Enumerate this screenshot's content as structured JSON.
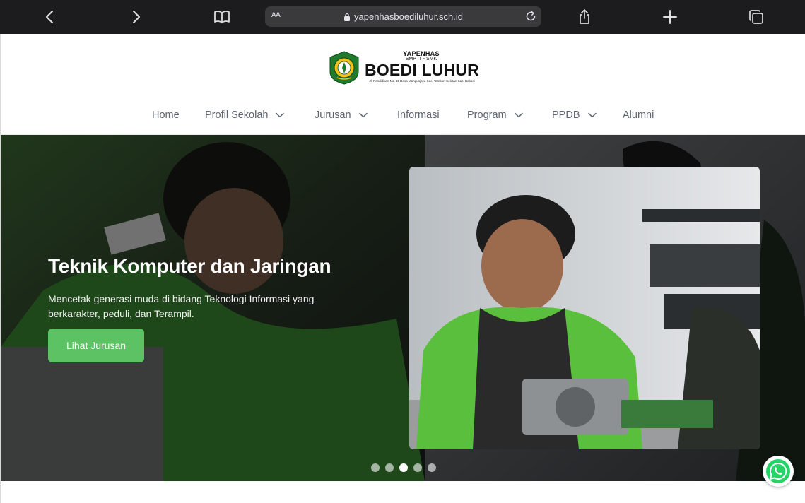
{
  "browser": {
    "aa_label": "AA",
    "url": "yapenhasboediluhur.sch.id"
  },
  "logo": {
    "line1": "YAPENHAS",
    "line2": "SMP IT - SMK",
    "name": "BOEDI LUHUR",
    "address": "Jl. Pendidikan No. 15 Desa Mangunjaya Kec. Tambun Selatan Kab. Bekasi"
  },
  "nav": {
    "items": [
      {
        "label": "Home",
        "dropdown": false
      },
      {
        "label": "Profil Sekolah",
        "dropdown": true
      },
      {
        "label": "Jurusan",
        "dropdown": true
      },
      {
        "label": "Informasi",
        "dropdown": false
      },
      {
        "label": "Program",
        "dropdown": true
      },
      {
        "label": "PPDB",
        "dropdown": true
      },
      {
        "label": "Alumni",
        "dropdown": false
      }
    ]
  },
  "hero": {
    "title": "Teknik Komputer dan Jaringan",
    "description": "Mencetak generasi muda di bidang Teknologi Informasi yang berkarakter, peduli, dan Terampil.",
    "button_label": "Lihat Jurusan",
    "slides_total": 5,
    "active_slide": 3
  },
  "colors": {
    "accent_green": "#5cc264",
    "nav_text": "#5b6470",
    "browser_bar": "#1c1c1e"
  },
  "icons": {
    "back": "chevron-left-icon",
    "forward": "chevron-right-icon",
    "bookmarks": "book-icon",
    "lock": "lock-icon",
    "reload": "reload-icon",
    "share": "share-icon",
    "new_tab": "plus-icon",
    "tabs": "tabs-icon",
    "whatsapp": "whatsapp-icon"
  }
}
